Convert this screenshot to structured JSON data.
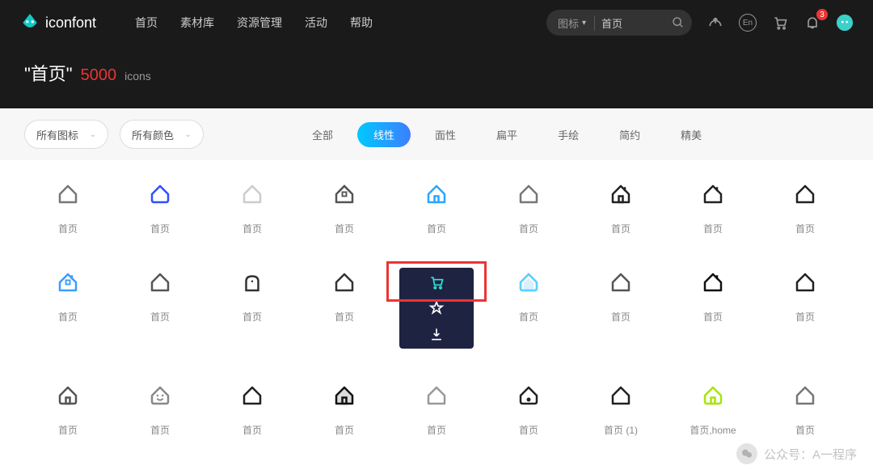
{
  "header": {
    "logo_text": "iconfont",
    "nav": [
      "首页",
      "素材库",
      "资源管理",
      "活动",
      "帮助"
    ],
    "search_category": "图标",
    "search_value": "首页",
    "language": "En",
    "notification_count": "3"
  },
  "title": {
    "query": "\"首页\"",
    "count": "5000",
    "label": "icons"
  },
  "filters": {
    "dropdown1": "所有图标",
    "dropdown2": "所有颜色",
    "tabs": [
      "全部",
      "线性",
      "面性",
      "扁平",
      "手绘",
      "简约",
      "精美"
    ],
    "active_tab_index": 1
  },
  "grid": {
    "rows": 3,
    "cols": 9,
    "label": "首页",
    "hover_index": 13,
    "label_row3_col7": "首页 (1)",
    "label_row3_col8": "首页,home",
    "icons": [
      {
        "c": "#777",
        "v": 0
      },
      {
        "c": "#2d4fff",
        "v": 1
      },
      {
        "c": "#ccc",
        "v": 0
      },
      {
        "c": "#555",
        "v": 2
      },
      {
        "c": "#2aa6ff",
        "v": 3
      },
      {
        "c": "#777",
        "v": 0
      },
      {
        "c": "#222",
        "v": 4
      },
      {
        "c": "#222",
        "v": 5
      },
      {
        "c": "#222",
        "v": 0
      },
      {
        "c": "#3b9dff",
        "v": 6
      },
      {
        "c": "#555",
        "v": 0
      },
      {
        "c": "#333",
        "v": 7
      },
      {
        "c": "#333",
        "v": 0
      },
      {
        "c": "#fff",
        "v": 0
      },
      {
        "c": "#5bd0ff",
        "v": 8
      },
      {
        "c": "#555",
        "v": 0
      },
      {
        "c": "#111",
        "v": 5
      },
      {
        "c": "#222",
        "v": 0
      },
      {
        "c": "#555",
        "v": 9
      },
      {
        "c": "#888",
        "v": 10
      },
      {
        "c": "#222",
        "v": 0
      },
      {
        "c": "#111",
        "v": 11
      },
      {
        "c": "#999",
        "v": 0
      },
      {
        "c": "#222",
        "v": 12
      },
      {
        "c": "#222",
        "v": 0
      },
      {
        "c": "#a8e40b",
        "v": 9
      },
      {
        "c": "#777",
        "v": 0
      }
    ]
  },
  "watermark": {
    "text": "公众号：A一程序"
  }
}
